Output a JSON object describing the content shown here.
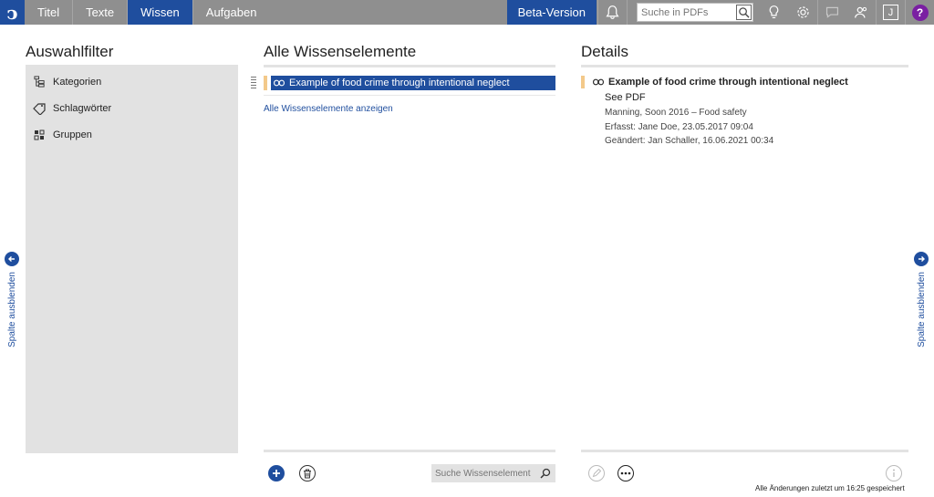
{
  "topbar": {
    "logo": "ͻ",
    "tabs": [
      {
        "label": "Titel"
      },
      {
        "label": "Texte"
      },
      {
        "label": "Wissen"
      },
      {
        "label": "Aufgaben"
      }
    ],
    "active_tab": "Wissen",
    "beta_label": "Beta-Version",
    "pdf_search_placeholder": "Suche in PDFs",
    "j_label": "J",
    "help_label": "?",
    "icons": [
      "bell-icon",
      "pdf-search-icon",
      "lightbulb-icon",
      "gear-icon",
      "chat-icon",
      "users-icon",
      "j-icon",
      "help-icon"
    ],
    "accent_color": "#1f4e9e",
    "bar_color": "#8f8f8f",
    "help_color": "#7a1fa2"
  },
  "side_toggle": {
    "label": "Spalte ausblenden"
  },
  "filters": {
    "title": "Auswahlfilter",
    "items": [
      {
        "label": "Kategorien",
        "icon": "categories-icon"
      },
      {
        "label": "Schlagwörter",
        "icon": "tag-icon"
      },
      {
        "label": "Gruppen",
        "icon": "groups-icon"
      }
    ]
  },
  "elements": {
    "title": "Alle Wissenselemente",
    "items": [
      {
        "label": "Example of food crime through intentional neglect",
        "icon": "link-icon",
        "marker_color": "#f3c98a"
      }
    ],
    "show_all_link": "Alle Wissenselemente anzeigen",
    "search_placeholder": "Suche Wissenselement"
  },
  "details": {
    "title": "Details",
    "item_title": "Example of food crime through intentional neglect",
    "content": "See PDF",
    "source": "Manning, Soon 2016 – Food safety",
    "created": "Erfasst: Jane Doe, 23.05.2017 09:04",
    "modified": "Geändert: Jan Schaller, 16.06.2021 00:34"
  },
  "status": "Alle Änderungen zuletzt um 16:25 gespeichert"
}
